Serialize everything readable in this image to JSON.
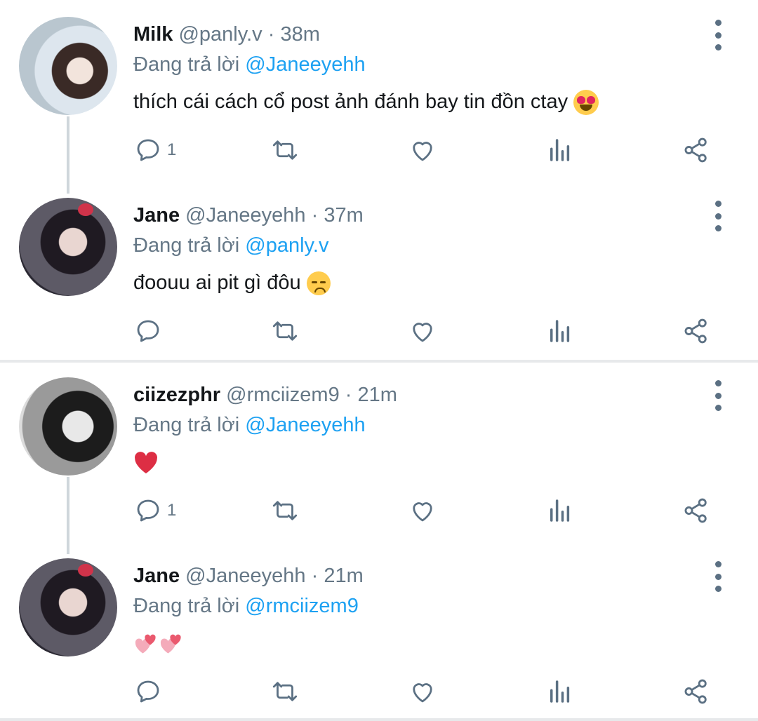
{
  "tweets": [
    {
      "name": "Milk",
      "handle": "@panly.v",
      "separator": "·",
      "time": "38m",
      "replying_prefix": "Đang trả lời",
      "replying_to": "@Janeeyehh",
      "text": "thích cái cách cổ post ảnh đánh bay tin đồn ctay",
      "emoji": "smiling-face-with-heart-eyes",
      "reply_count": "1"
    },
    {
      "name": "Jane",
      "handle": "@Janeeyehh",
      "separator": "·",
      "time": "37m",
      "replying_prefix": "Đang trả lời",
      "replying_to": "@panly.v",
      "text": "đoouu ai pit gì đôu",
      "emoji": "disappointed-face",
      "reply_count": ""
    },
    {
      "name": "ciizezphr",
      "handle": "@rmciizem9",
      "separator": "·",
      "time": "21m",
      "replying_prefix": "Đang trả lời",
      "replying_to": "@Janeeyehh",
      "text": "",
      "emoji": "red-heart",
      "reply_count": "1"
    },
    {
      "name": "Jane",
      "handle": "@Janeeyehh",
      "separator": "·",
      "time": "21m",
      "replying_prefix": "Đang trả lời",
      "replying_to": "@rmciizem9",
      "text": "",
      "emoji": "two-hearts-x2",
      "reply_count": ""
    }
  ],
  "icons": {
    "reply": "reply-icon",
    "retweet": "retweet-icon",
    "like": "like-icon",
    "stats": "stats-icon",
    "share": "share-icon",
    "more": "more-options-icon"
  },
  "colors": {
    "name": "#14171a",
    "secondary": "#657786",
    "mention": "#1da1f2",
    "icon": "#5b7083",
    "divider": "#e7e9eb"
  }
}
